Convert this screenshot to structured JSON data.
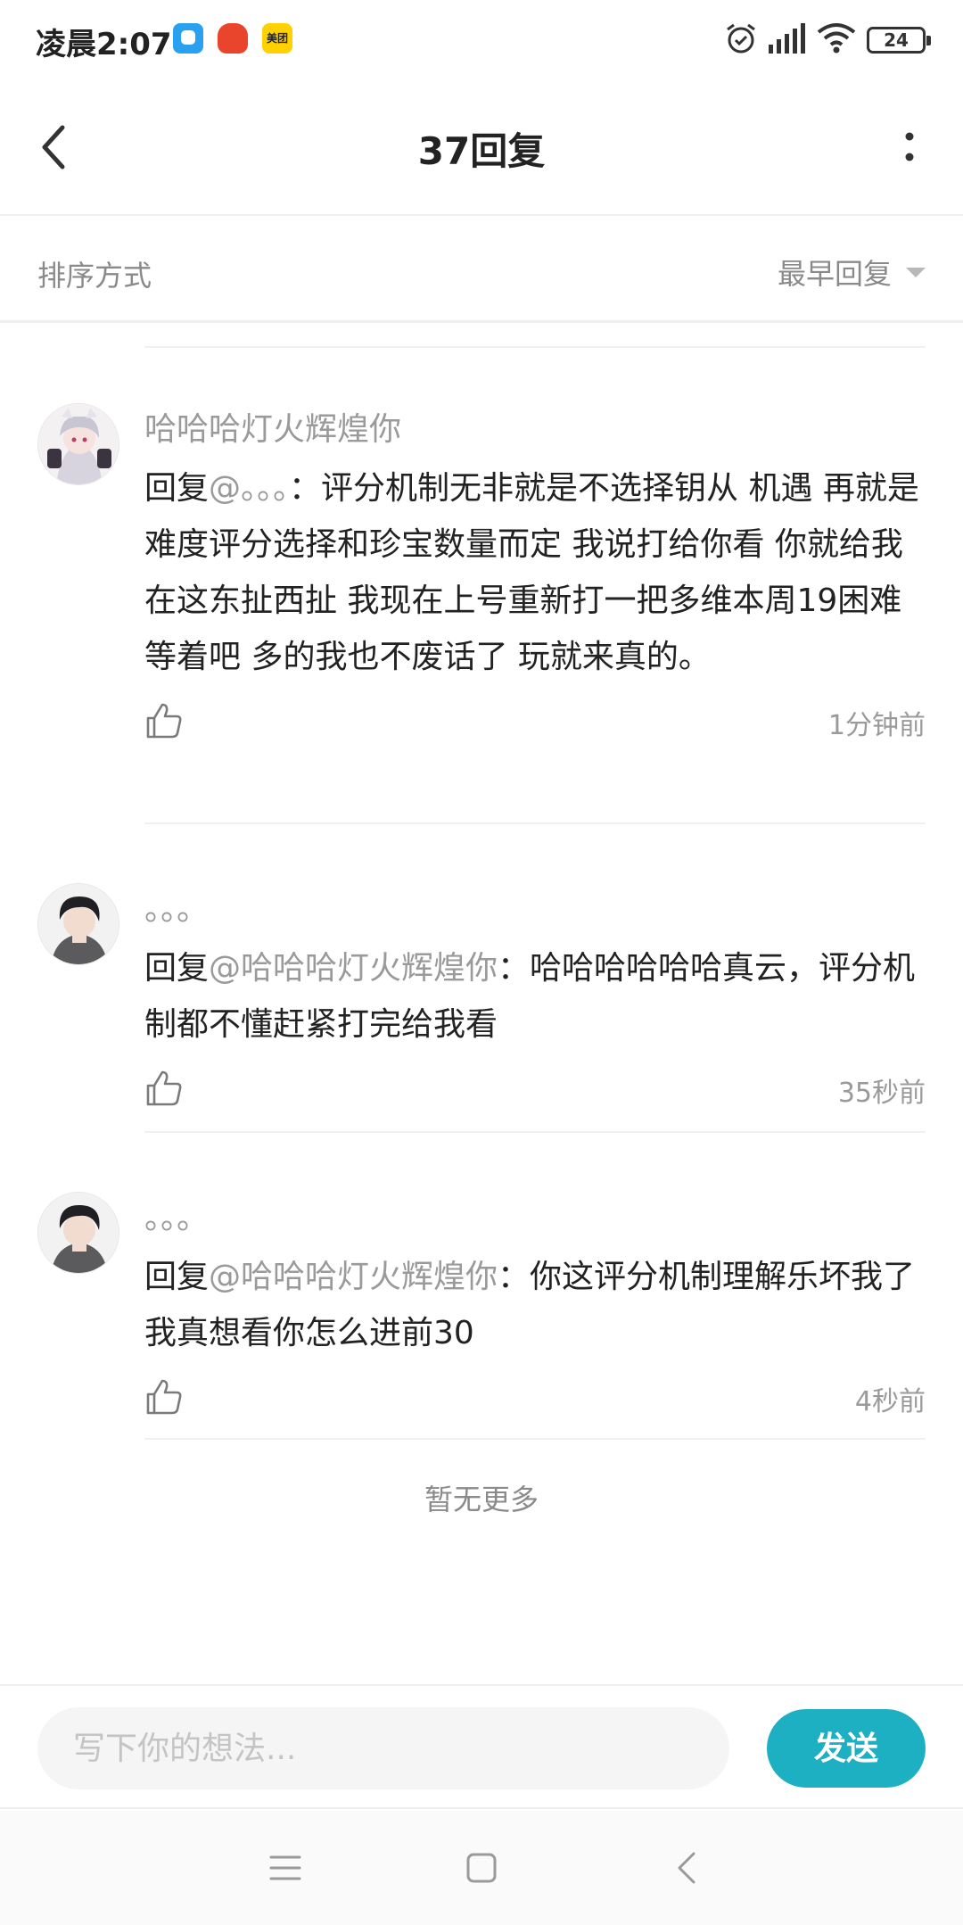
{
  "status_bar": {
    "time": "凌晨2:07",
    "app_icons": [
      "message-app-icon",
      "game-app-icon",
      "meituan-app-icon"
    ],
    "meituan_label": "美团",
    "battery": "24"
  },
  "header": {
    "title": "37回复",
    "back_icon": "chevron-left-icon",
    "more_icon": "more-vertical-icon"
  },
  "sort": {
    "label": "排序方式",
    "selected": "最早回复"
  },
  "comments": [
    {
      "author": "哈哈哈灯火辉煌你",
      "reply_prefix": "回复",
      "mention": "@。。。",
      "text": "：评分机制无非就是不选择钥从 机遇 再就是难度评分选择和珍宝数量而定 我说打给你看 你就给我在这东扯西扯  我现在上号重新打一把多维本周19困难  等着吧 多的我也不废话了 玩就来真的。",
      "time": "1分钟前"
    },
    {
      "author": "。。。",
      "reply_prefix": "回复",
      "mention": "@哈哈哈灯火辉煌你",
      "text": "：哈哈哈哈哈哈真云，评分机制都不懂赶紧打完给我看",
      "time": "35秒前"
    },
    {
      "author": "。。。",
      "reply_prefix": "回复",
      "mention": "@哈哈哈灯火辉煌你",
      "text": "：你这评分机制理解乐坏我了我真想看你怎么进前30",
      "time": "4秒前"
    }
  ],
  "no_more": "暂无更多",
  "input": {
    "placeholder": "写下你的想法...",
    "value": "",
    "send_label": "发送"
  },
  "colors": {
    "accent": "#1db0c3",
    "muted_text": "#9a9a9a"
  }
}
